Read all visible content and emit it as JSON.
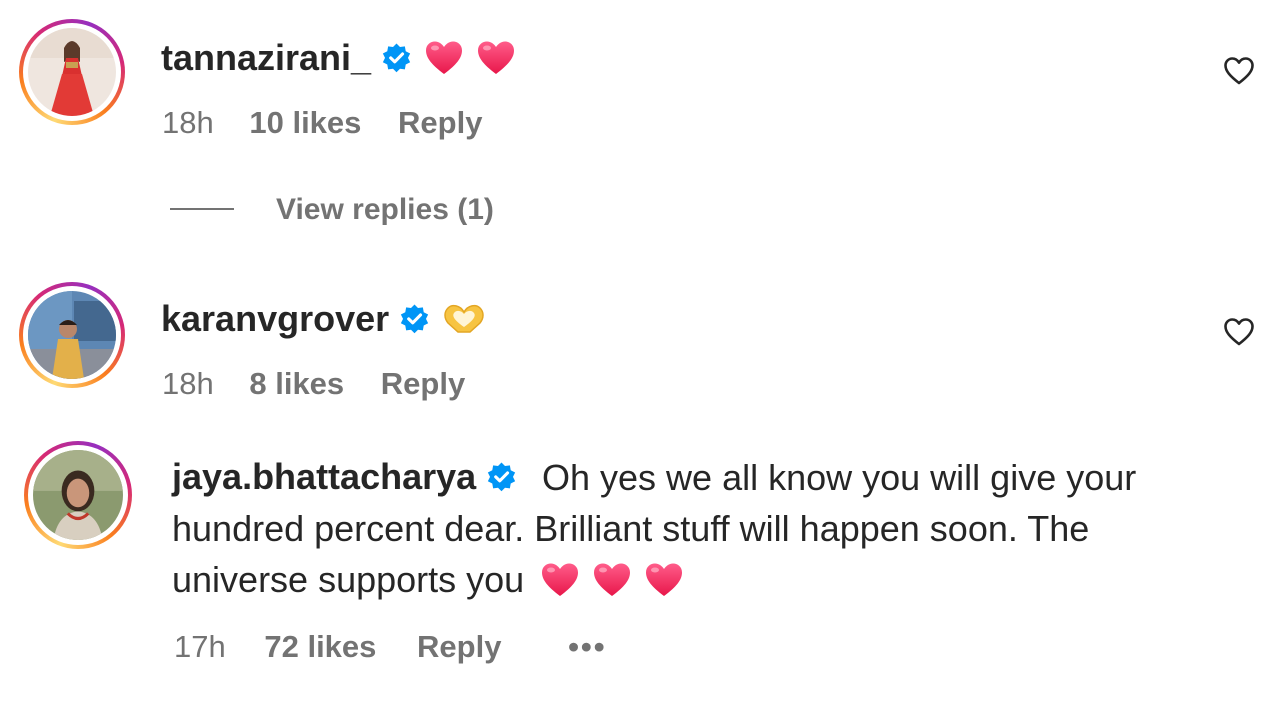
{
  "colors": {
    "text": "#262626",
    "secondary": "#737373",
    "verified": "#0095f6",
    "heart": "#ff2f5b"
  },
  "comments": [
    {
      "username": "tannazirani_",
      "text": "",
      "emojis": [
        "red-heart",
        "red-heart"
      ],
      "time": "18h",
      "likes": "10 likes",
      "reply_label": "Reply",
      "verified": true
    },
    {
      "username": "karanvgrover",
      "text": "",
      "emojis": [
        "heart-hands"
      ],
      "time": "18h",
      "likes": "8 likes",
      "reply_label": "Reply",
      "verified": true
    },
    {
      "username": "jaya.bhattacharya",
      "text": "Oh yes we all know you will give your hundred percent dear. Brilliant stuff will happen soon. The universe supports you",
      "emojis": [
        "red-heart",
        "red-heart",
        "red-heart"
      ],
      "time": "17h",
      "likes": "72 likes",
      "reply_label": "Reply",
      "more_label": "•••",
      "verified": true
    }
  ],
  "view_replies_label": "View replies (1)"
}
